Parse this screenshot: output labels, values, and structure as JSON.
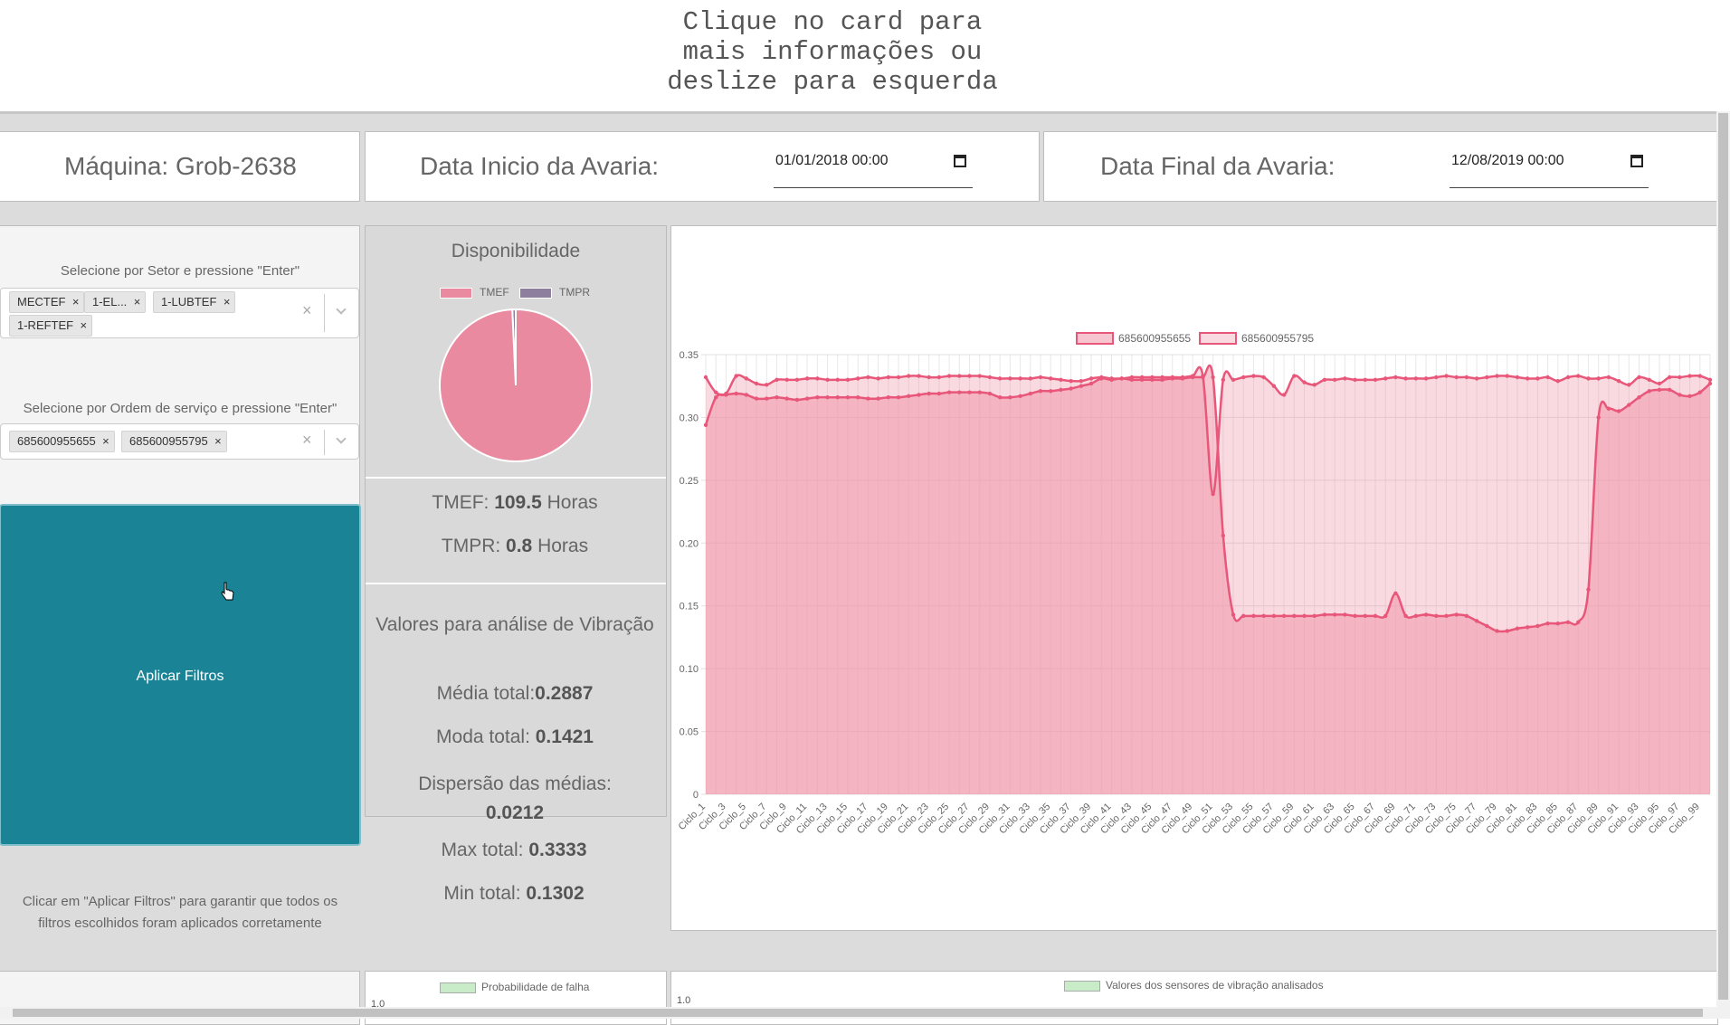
{
  "hint": "Clique no card para\nmais informações ou\ndeslize para esquerda",
  "header": {
    "machine_label": "Máquina: Grob-2638",
    "start_label": "Data Inicio da Avaria:",
    "start_value": "01/01/2018 00:00",
    "end_label": "Data Final da Avaria:",
    "end_value": "12/08/2019 00:00"
  },
  "filters": {
    "sector_label": "Selecione por Setor e pressione \"Enter\"",
    "sector_tags": [
      "MECTEF",
      "1-EL...",
      "1-LUBTEF",
      "1-REFTEF"
    ],
    "order_label": "Selecione por Ordem de serviço e pressione \"Enter\"",
    "order_tags": [
      "685600955655",
      "685600955795"
    ],
    "apply_label": "Aplicar Filtros",
    "note": "Clicar em \"Aplicar Filtros\" para garantir que todos os filtros escolhidos foram aplicados corretamente"
  },
  "availability": {
    "title": "Disponibilidade",
    "legend": [
      "TMEF",
      "TMPR"
    ],
    "colors": [
      "#e98aa0",
      "#8e7f9e"
    ],
    "tmef_prefix": "TMEF: ",
    "tmef_value": "109.5",
    "tmef_unit": " Horas",
    "tmpr_prefix": "TMPR: ",
    "tmpr_value": "0.8",
    "tmpr_unit": " Horas",
    "pie_values": [
      109.5,
      0.8
    ]
  },
  "vibration": {
    "title": "Valores para análise de Vibração",
    "media_label": "Média total:",
    "media_value": "0.2887",
    "moda_label": "Moda total: ",
    "moda_value": "0.1421",
    "disp_label": "Dispersão das médias:",
    "disp_value": "0.0212",
    "max_label": "Max total: ",
    "max_value": "0.3333",
    "min_label": "Min total: ",
    "min_value": "0.1302"
  },
  "bottom": {
    "legend_left": "Probabilidade de falha",
    "legend_right": "Valores dos sensores de vibração analisados",
    "left_tick": "1.0",
    "right_tick": "1.0"
  },
  "chart_data": {
    "type": "area",
    "x_prefix": "Ciclo_",
    "x_count": 100,
    "x_label_step": 2,
    "ylim": [
      0,
      0.35
    ],
    "yticks": [
      "0",
      "0.05",
      "0.10",
      "0.15",
      "0.20",
      "0.25",
      "0.30",
      "0.35"
    ],
    "grid": true,
    "legend_position": "top",
    "series": [
      {
        "name": "685600955655",
        "color": "#e8577a",
        "fill": "rgba(240,150,170,0.55)",
        "values": [
          0.294,
          0.316,
          0.318,
          0.319,
          0.318,
          0.315,
          0.315,
          0.316,
          0.315,
          0.314,
          0.315,
          0.316,
          0.316,
          0.316,
          0.316,
          0.316,
          0.315,
          0.315,
          0.316,
          0.316,
          0.317,
          0.318,
          0.319,
          0.319,
          0.32,
          0.32,
          0.32,
          0.32,
          0.319,
          0.316,
          0.316,
          0.317,
          0.319,
          0.321,
          0.321,
          0.322,
          0.323,
          0.325,
          0.327,
          0.331,
          0.33,
          0.331,
          0.33,
          0.33,
          0.33,
          0.33,
          0.331,
          0.331,
          0.332,
          0.332,
          0.332,
          0.206,
          0.143,
          0.142,
          0.142,
          0.142,
          0.142,
          0.142,
          0.142,
          0.142,
          0.142,
          0.143,
          0.143,
          0.143,
          0.142,
          0.142,
          0.142,
          0.142,
          0.16,
          0.142,
          0.142,
          0.143,
          0.142,
          0.142,
          0.143,
          0.142,
          0.138,
          0.134,
          0.13,
          0.13,
          0.132,
          0.133,
          0.134,
          0.136,
          0.136,
          0.137,
          0.137,
          0.163,
          0.3,
          0.307,
          0.305,
          0.31,
          0.316,
          0.321,
          0.322,
          0.322,
          0.318,
          0.317,
          0.32,
          0.327
        ]
      },
      {
        "name": "685600955795",
        "color": "#e8577a",
        "fill": "rgba(240,150,170,0.35)",
        "values": [
          0.332,
          0.32,
          0.319,
          0.333,
          0.331,
          0.327,
          0.326,
          0.33,
          0.33,
          0.33,
          0.331,
          0.331,
          0.33,
          0.33,
          0.33,
          0.331,
          0.332,
          0.331,
          0.332,
          0.332,
          0.333,
          0.333,
          0.332,
          0.332,
          0.333,
          0.333,
          0.333,
          0.333,
          0.332,
          0.331,
          0.331,
          0.331,
          0.331,
          0.332,
          0.331,
          0.33,
          0.329,
          0.329,
          0.331,
          0.332,
          0.331,
          0.331,
          0.332,
          0.332,
          0.332,
          0.332,
          0.332,
          0.332,
          0.333,
          0.333,
          0.239,
          0.33,
          0.33,
          0.332,
          0.333,
          0.332,
          0.325,
          0.318,
          0.333,
          0.328,
          0.326,
          0.33,
          0.33,
          0.331,
          0.33,
          0.33,
          0.33,
          0.331,
          0.332,
          0.331,
          0.331,
          0.331,
          0.332,
          0.333,
          0.332,
          0.332,
          0.331,
          0.332,
          0.333,
          0.333,
          0.332,
          0.331,
          0.331,
          0.332,
          0.329,
          0.332,
          0.333,
          0.331,
          0.331,
          0.332,
          0.329,
          0.326,
          0.332,
          0.33,
          0.327,
          0.332,
          0.332,
          0.333,
          0.333,
          0.33
        ]
      }
    ]
  }
}
